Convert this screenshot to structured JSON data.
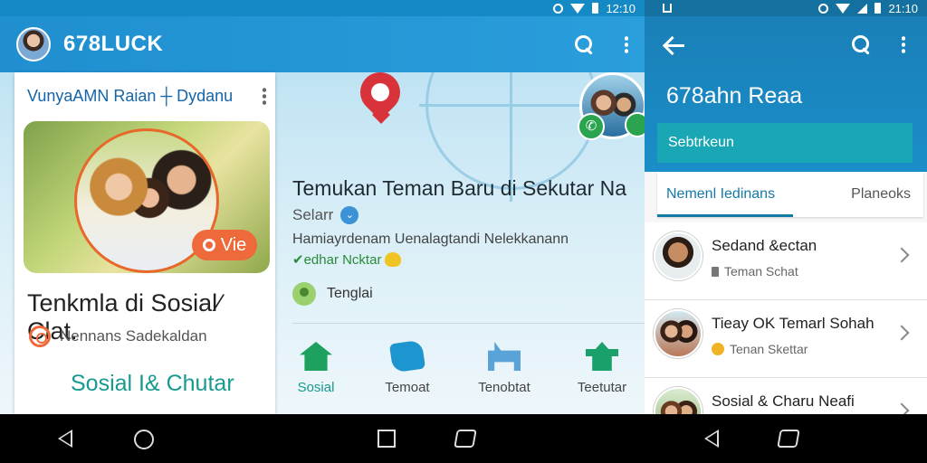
{
  "status": {
    "left_time": "12:10",
    "right_time": "21:10"
  },
  "left_app": {
    "title": "678LUCK"
  },
  "feed_card": {
    "header": "VunyaAMN Raian ┼ Dydanu",
    "live_label": "Vie",
    "title": "Tenkmla di Sosial⁄ Clat.",
    "subtitle": "Nennans Sadekaldan",
    "link": "Sosial I& Chutar"
  },
  "center": {
    "title": "Temukan Teman Baru di Sekutar Na",
    "small_label": "Selarr",
    "description": "Hamiayrdenam Uenalagtandi Nelekkanann",
    "tag": "✔edhar Ncktar",
    "location": "Tenglai"
  },
  "bottom_tabs": [
    {
      "label": "Sosial",
      "active": true,
      "icon": "home-icon"
    },
    {
      "label": "Temoat",
      "active": false,
      "icon": "chat-icon"
    },
    {
      "label": "Tenobtat",
      "active": false,
      "icon": "cat-icon"
    },
    {
      "label": "Teetutar",
      "active": false,
      "icon": "place-icon"
    }
  ],
  "right_app": {
    "title": "678ahn Reaa",
    "button": "Sebtrkeun",
    "tabs": [
      "Nemenl Iedinans",
      "Planeoks"
    ],
    "contacts": [
      {
        "name": "Sedand &ectan",
        "sub": "Teman Schat"
      },
      {
        "name": "Tieay OK Temarl Sohah",
        "sub": "Tenan Skettar"
      },
      {
        "name": "Sosial & Charu Neafi",
        "sub": ""
      }
    ]
  },
  "colors": {
    "primary": "#1f8fcf",
    "accent_orange": "#ee6a3a",
    "accent_teal": "#179a8f",
    "call_green": "#2aa44f"
  }
}
